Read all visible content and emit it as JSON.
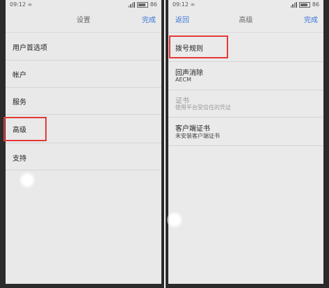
{
  "left_screen": {
    "status": {
      "time": "09:12 ∞",
      "battery": "86"
    },
    "header": {
      "title": "设置",
      "done_label": "完成"
    },
    "items": [
      {
        "label": "用户首选项"
      },
      {
        "label": "帐户"
      },
      {
        "label": "服务"
      },
      {
        "label": "高级"
      },
      {
        "label": "支持"
      }
    ]
  },
  "right_screen": {
    "status": {
      "time": "09:12 ∞",
      "battery": "86"
    },
    "header": {
      "back_label": "返回",
      "title": "高级",
      "done_label": "完成"
    },
    "items": [
      {
        "label": "拨号规则",
        "sub": ""
      },
      {
        "label": "回声消除",
        "sub": "AECM"
      },
      {
        "label": "证书",
        "sub": "使用平台受信任的凭证"
      },
      {
        "label": "客户端证书",
        "sub": "未安装客户端证书"
      }
    ]
  },
  "colors": {
    "accent": "#3a76d6",
    "highlight": "#e53935"
  }
}
